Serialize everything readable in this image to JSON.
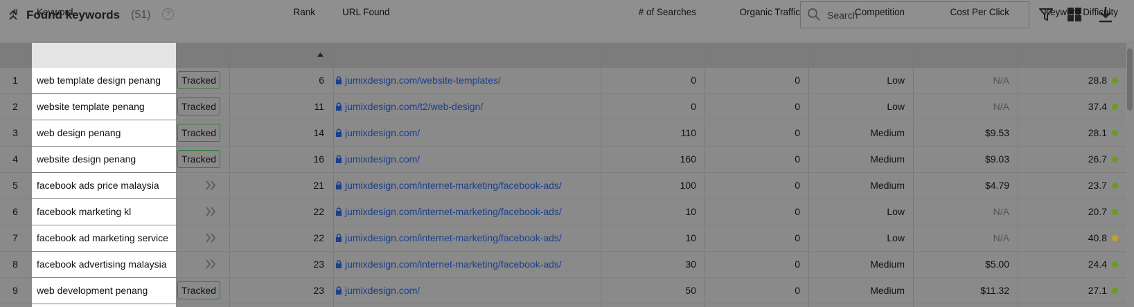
{
  "panel": {
    "title": "Found keywords",
    "count": "(51)",
    "help": "?",
    "search_placeholder": "Search"
  },
  "columns": {
    "num": "#",
    "keyword": "Keyword",
    "rank": "Rank",
    "url": "URL Found",
    "searches": "# of Searches",
    "traffic": "Organic Traffic",
    "competition": "Competition",
    "cpc": "Cost Per Click",
    "difficulty": "Keyword Difficulty"
  },
  "colors": {
    "tracked_border": "#2e7d32",
    "link": "#1a3f8f",
    "dot_green": "#6a9a1f",
    "dot_yellow": "#c8a21a"
  },
  "rows": [
    {
      "num": "1",
      "keyword": "web template design penang",
      "status": "Tracked",
      "rank": "6",
      "url": "jumixdesign.com/website-templates/",
      "searches": "0",
      "traffic": "0",
      "competition": "Low",
      "cpc": "N/A",
      "difficulty": "28.8",
      "dot": "green"
    },
    {
      "num": "2",
      "keyword": "website template penang",
      "status": "Tracked",
      "rank": "11",
      "url": "jumixdesign.com/t2/web-design/",
      "searches": "0",
      "traffic": "0",
      "competition": "Low",
      "cpc": "N/A",
      "difficulty": "37.4",
      "dot": "green"
    },
    {
      "num": "3",
      "keyword": "web design penang",
      "status": "Tracked",
      "rank": "14",
      "url": "jumixdesign.com/",
      "searches": "110",
      "traffic": "0",
      "competition": "Medium",
      "cpc": "$9.53",
      "difficulty": "28.1",
      "dot": "green"
    },
    {
      "num": "4",
      "keyword": "website design penang",
      "status": "Tracked",
      "rank": "16",
      "url": "jumixdesign.com/",
      "searches": "160",
      "traffic": "0",
      "competition": "Medium",
      "cpc": "$9.03",
      "difficulty": "26.7",
      "dot": "green"
    },
    {
      "num": "5",
      "keyword": "facebook ads price malaysia",
      "status": "",
      "rank": "21",
      "url": "jumixdesign.com/internet-marketing/facebook-ads/",
      "searches": "100",
      "traffic": "0",
      "competition": "Medium",
      "cpc": "$4.79",
      "difficulty": "23.7",
      "dot": "green"
    },
    {
      "num": "6",
      "keyword": "facebook marketing kl",
      "status": "",
      "rank": "22",
      "url": "jumixdesign.com/internet-marketing/facebook-ads/",
      "searches": "10",
      "traffic": "0",
      "competition": "Low",
      "cpc": "N/A",
      "difficulty": "20.7",
      "dot": "green"
    },
    {
      "num": "7",
      "keyword": "facebook ad marketing service",
      "status": "",
      "rank": "22",
      "url": "jumixdesign.com/internet-marketing/facebook-ads/",
      "searches": "10",
      "traffic": "0",
      "competition": "Low",
      "cpc": "N/A",
      "difficulty": "40.8",
      "dot": "yellow"
    },
    {
      "num": "8",
      "keyword": "facebook advertising malaysia",
      "status": "",
      "rank": "23",
      "url": "jumixdesign.com/internet-marketing/facebook-ads/",
      "searches": "30",
      "traffic": "0",
      "competition": "Medium",
      "cpc": "$5.00",
      "difficulty": "24.4",
      "dot": "green"
    },
    {
      "num": "9",
      "keyword": "web development penang",
      "status": "Tracked",
      "rank": "23",
      "url": "jumixdesign.com/",
      "searches": "50",
      "traffic": "0",
      "competition": "Medium",
      "cpc": "$11.32",
      "difficulty": "27.1",
      "dot": "green"
    }
  ]
}
